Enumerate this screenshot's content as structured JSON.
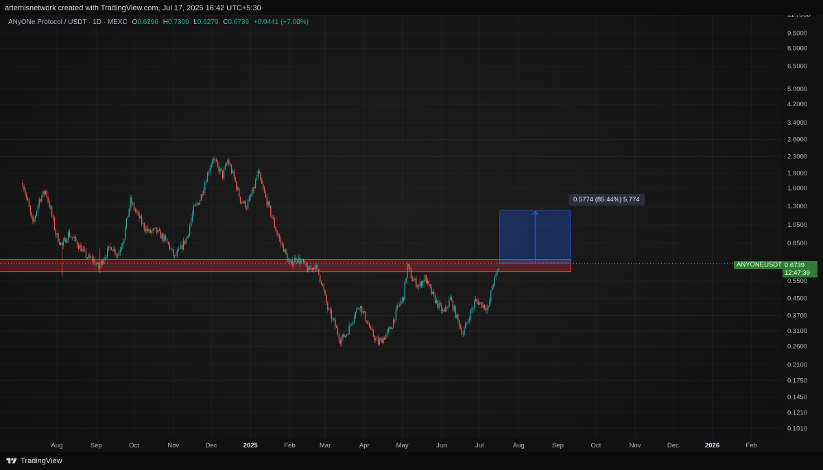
{
  "header": {
    "created_by": "artemisnetwork created with TradingView.com, Jul 17, 2025 16:42 UTC+5:30"
  },
  "legend": {
    "symbol": "ANyONe Protocol / USDT · 1D · MEXC",
    "open_key": "O",
    "open": "0.6296",
    "high_key": "H",
    "high": "0.7309",
    "low_key": "L",
    "low": "0.6279",
    "close_key": "C",
    "close": "0.6739",
    "change": "+0.0441 (+7.00%)"
  },
  "price_tag": {
    "ticker": "ANYONEUSDT",
    "price": "0.6739",
    "countdown": "12:47:39"
  },
  "measure": {
    "label": "0.5774 (85.44%) 5,774"
  },
  "footer": {
    "brand": "TradingView"
  },
  "colors": {
    "up": "#26a69a",
    "down": "#ef5350",
    "zone": "#f23645",
    "measure": "#2962ff",
    "badge": "#2e7d32"
  },
  "chart_data": {
    "type": "candlestick",
    "y_scale": "log",
    "ylim": [
      0.09,
      11.7
    ],
    "x_range": [
      "2024-06-17",
      "2026-02-25"
    ],
    "y_ticks": [
      {
        "v": 11.7,
        "label": "11.7000"
      },
      {
        "v": 9.5,
        "label": "9.5000"
      },
      {
        "v": 8.0,
        "label": "8.0000"
      },
      {
        "v": 6.5,
        "label": "6.5000"
      },
      {
        "v": 5.0,
        "label": "5.0000"
      },
      {
        "v": 4.2,
        "label": "4.2000"
      },
      {
        "v": 3.4,
        "label": "3.4000"
      },
      {
        "v": 2.8,
        "label": "2.8000"
      },
      {
        "v": 2.3,
        "label": "2.3000"
      },
      {
        "v": 1.9,
        "label": "1.9000"
      },
      {
        "v": 1.6,
        "label": "1.6000"
      },
      {
        "v": 1.3,
        "label": "1.3000"
      },
      {
        "v": 1.05,
        "label": "1.0500"
      },
      {
        "v": 0.85,
        "label": "0.8500"
      },
      {
        "v": 0.67,
        "label": "0.6700"
      },
      {
        "v": 0.55,
        "label": "0.5500"
      },
      {
        "v": 0.45,
        "label": "0.4500"
      },
      {
        "v": 0.37,
        "label": "0.3700"
      },
      {
        "v": 0.31,
        "label": "0.3100"
      },
      {
        "v": 0.26,
        "label": "0.2600"
      },
      {
        "v": 0.21,
        "label": "0.2100"
      },
      {
        "v": 0.175,
        "label": "0.1750"
      },
      {
        "v": 0.145,
        "label": "0.1450"
      },
      {
        "v": 0.121,
        "label": "0.1210"
      },
      {
        "v": 0.101,
        "label": "0.1010"
      }
    ],
    "x_ticks": [
      {
        "d": "2024-08-01",
        "label": "Aug"
      },
      {
        "d": "2024-09-01",
        "label": "Sep"
      },
      {
        "d": "2024-10-01",
        "label": "Oct"
      },
      {
        "d": "2024-11-01",
        "label": "Nov"
      },
      {
        "d": "2024-12-01",
        "label": "Dec"
      },
      {
        "d": "2025-01-01",
        "label": "2025",
        "bold": true
      },
      {
        "d": "2025-02-01",
        "label": "Feb"
      },
      {
        "d": "2025-03-01",
        "label": "Mar"
      },
      {
        "d": "2025-04-01",
        "label": "Apr"
      },
      {
        "d": "2025-05-01",
        "label": "May"
      },
      {
        "d": "2025-06-01",
        "label": "Jun"
      },
      {
        "d": "2025-07-01",
        "label": "Jul"
      },
      {
        "d": "2025-08-01",
        "label": "Aug"
      },
      {
        "d": "2025-09-01",
        "label": "Sep"
      },
      {
        "d": "2025-10-01",
        "label": "Oct"
      },
      {
        "d": "2025-11-01",
        "label": "Nov"
      },
      {
        "d": "2025-12-01",
        "label": "Dec"
      },
      {
        "d": "2026-01-01",
        "label": "2026",
        "bold": true
      },
      {
        "d": "2026-02-01",
        "label": "Feb"
      }
    ],
    "close_path": [
      [
        "2024-07-05",
        1.7
      ],
      [
        "2024-07-09",
        1.35
      ],
      [
        "2024-07-13",
        1.05
      ],
      [
        "2024-07-18",
        1.4
      ],
      [
        "2024-07-23",
        1.55
      ],
      [
        "2024-07-27",
        1.25
      ],
      [
        "2024-07-31",
        0.95
      ],
      [
        "2024-08-05",
        0.82
      ],
      [
        "2024-08-10",
        0.95
      ],
      [
        "2024-08-15",
        0.88
      ],
      [
        "2024-08-20",
        0.8
      ],
      [
        "2024-08-25",
        0.72
      ],
      [
        "2024-08-30",
        0.7
      ],
      [
        "2024-09-03",
        0.64
      ],
      [
        "2024-09-08",
        0.74
      ],
      [
        "2024-09-13",
        0.82
      ],
      [
        "2024-09-18",
        0.74
      ],
      [
        "2024-09-23",
        0.92
      ],
      [
        "2024-09-28",
        1.38
      ],
      [
        "2024-10-03",
        1.2
      ],
      [
        "2024-10-08",
        1.05
      ],
      [
        "2024-10-13",
        0.96
      ],
      [
        "2024-10-18",
        0.98
      ],
      [
        "2024-10-23",
        0.92
      ],
      [
        "2024-10-28",
        0.84
      ],
      [
        "2024-11-02",
        0.72
      ],
      [
        "2024-11-07",
        0.8
      ],
      [
        "2024-11-12",
        0.92
      ],
      [
        "2024-11-17",
        1.25
      ],
      [
        "2024-11-22",
        1.4
      ],
      [
        "2024-11-27",
        1.8
      ],
      [
        "2024-12-02",
        2.25
      ],
      [
        "2024-12-06",
        2.05
      ],
      [
        "2024-12-10",
        1.85
      ],
      [
        "2024-12-14",
        2.2
      ],
      [
        "2024-12-19",
        1.8
      ],
      [
        "2024-12-24",
        1.4
      ],
      [
        "2024-12-29",
        1.3
      ],
      [
        "2025-01-03",
        1.55
      ],
      [
        "2025-01-07",
        1.9
      ],
      [
        "2025-01-12",
        1.5
      ],
      [
        "2025-01-17",
        1.2
      ],
      [
        "2025-01-22",
        0.95
      ],
      [
        "2025-01-27",
        0.8
      ],
      [
        "2025-02-01",
        0.66
      ],
      [
        "2025-02-06",
        0.72
      ],
      [
        "2025-02-11",
        0.68
      ],
      [
        "2025-02-16",
        0.62
      ],
      [
        "2025-02-21",
        0.66
      ],
      [
        "2025-02-26",
        0.55
      ],
      [
        "2025-03-03",
        0.4
      ],
      [
        "2025-03-08",
        0.34
      ],
      [
        "2025-03-13",
        0.28
      ],
      [
        "2025-03-18",
        0.3
      ],
      [
        "2025-03-23",
        0.36
      ],
      [
        "2025-03-28",
        0.42
      ],
      [
        "2025-04-02",
        0.36
      ],
      [
        "2025-04-07",
        0.3
      ],
      [
        "2025-04-12",
        0.27
      ],
      [
        "2025-04-17",
        0.29
      ],
      [
        "2025-04-22",
        0.32
      ],
      [
        "2025-04-27",
        0.4
      ],
      [
        "2025-05-02",
        0.46
      ],
      [
        "2025-05-05",
        0.66
      ],
      [
        "2025-05-09",
        0.56
      ],
      [
        "2025-05-14",
        0.52
      ],
      [
        "2025-05-19",
        0.57
      ],
      [
        "2025-05-24",
        0.48
      ],
      [
        "2025-05-29",
        0.42
      ],
      [
        "2025-06-03",
        0.38
      ],
      [
        "2025-06-08",
        0.45
      ],
      [
        "2025-06-13",
        0.36
      ],
      [
        "2025-06-18",
        0.3
      ],
      [
        "2025-06-23",
        0.37
      ],
      [
        "2025-06-28",
        0.44
      ],
      [
        "2025-07-03",
        0.42
      ],
      [
        "2025-07-08",
        0.4
      ],
      [
        "2025-07-11",
        0.52
      ],
      [
        "2025-07-14",
        0.58
      ],
      [
        "2025-07-17",
        0.6739
      ]
    ],
    "support_zone": {
      "from": "2024-06-16",
      "to": "2025-09-11",
      "top": 0.706,
      "bottom": 0.612
    },
    "measure_box": {
      "from": "2025-07-17",
      "to": "2025-09-11",
      "low": 0.6739,
      "high": 1.24
    },
    "last_price": 0.6739
  }
}
